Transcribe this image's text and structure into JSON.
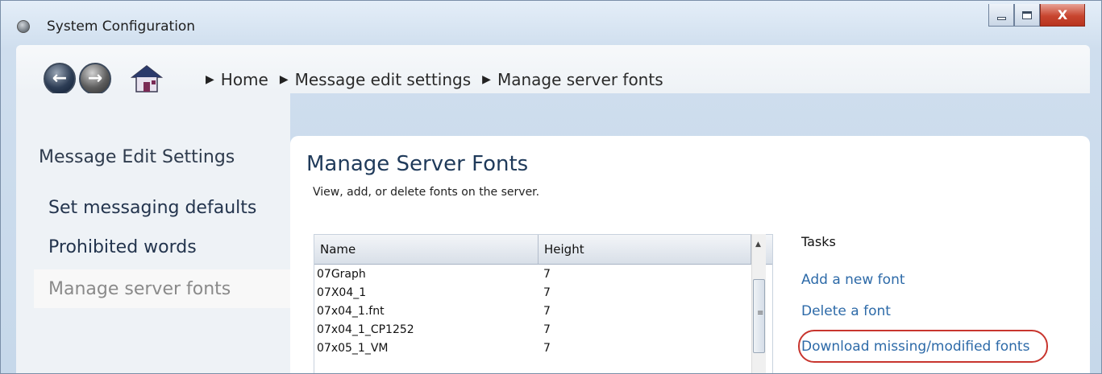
{
  "window": {
    "title": "System Configuration",
    "app_icon": "system-config-icon"
  },
  "window_controls": {
    "minimize_icon": "minimize-icon",
    "maximize_icon": "maximize-icon",
    "close_icon": "close-icon",
    "close_glyph": "X"
  },
  "nav": {
    "back_icon": "back-arrow-icon",
    "forward_icon": "forward-arrow-icon",
    "home_icon": "home-icon",
    "breadcrumb": [
      "Home",
      "Message edit settings",
      "Manage server fonts"
    ]
  },
  "sidebar": {
    "heading": "Message Edit Settings",
    "items": [
      {
        "label": "Set messaging defaults"
      },
      {
        "label": "Prohibited words"
      },
      {
        "label": "Manage server fonts",
        "selected": true
      }
    ]
  },
  "main": {
    "title": "Manage Server Fonts",
    "subtitle": "View, add, or delete fonts on the server.",
    "grid": {
      "columns": [
        "Name",
        "Height"
      ],
      "rows": [
        [
          "07Graph",
          "7"
        ],
        [
          "07X04_1",
          "7"
        ],
        [
          "07x04_1.fnt",
          "7"
        ],
        [
          "07x04_1_CP1252",
          "7"
        ],
        [
          "07x05_1_VM",
          "7"
        ]
      ]
    },
    "tasks": {
      "heading": "Tasks",
      "items": [
        "Add a new font",
        "Delete a font",
        "Download missing/modified fonts"
      ]
    }
  },
  "colors": {
    "link": "#2d6aa8",
    "highlight_ring": "#c8352e",
    "selected_item_text": "#8a8a8a"
  }
}
